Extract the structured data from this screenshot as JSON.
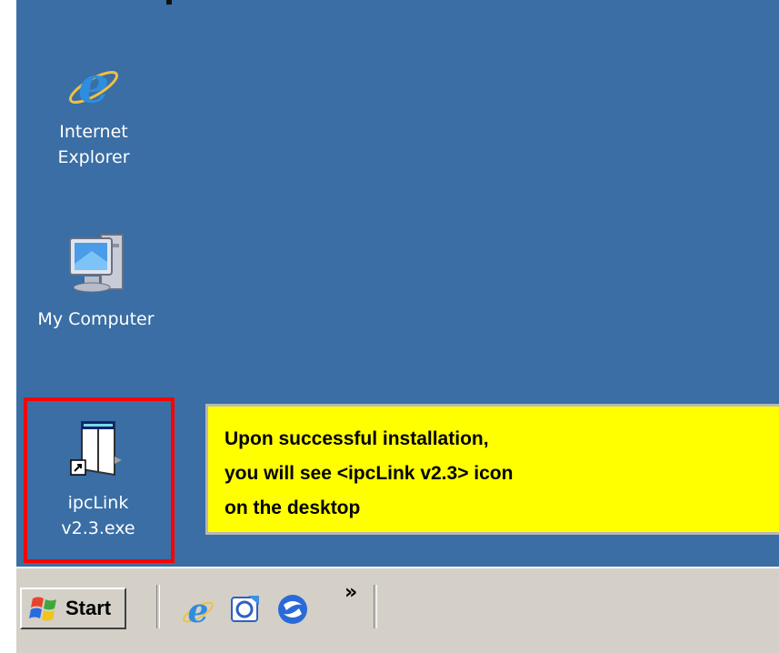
{
  "desktop": {
    "icons": [
      {
        "label_line1": "Internet",
        "label_line2": "Explorer",
        "icon": "internet-explorer-icon"
      },
      {
        "label": "My Computer",
        "icon": "my-computer-icon"
      },
      {
        "label_line1": "ipcLink",
        "label_line2": "v2.3.exe",
        "icon": "ipclink-shortcut-icon"
      }
    ]
  },
  "callout": {
    "lines": [
      "Upon successful installation,",
      "you will see <ipcLink v2.3> icon",
      "on the desktop"
    ],
    "background": "#ffff00",
    "highlight_border": "#ff0000"
  },
  "taskbar": {
    "start_label": "Start",
    "quick_launch": [
      "internet-explorer-icon",
      "outlook-express-icon",
      "media-player-icon"
    ],
    "overflow_label": "»"
  }
}
